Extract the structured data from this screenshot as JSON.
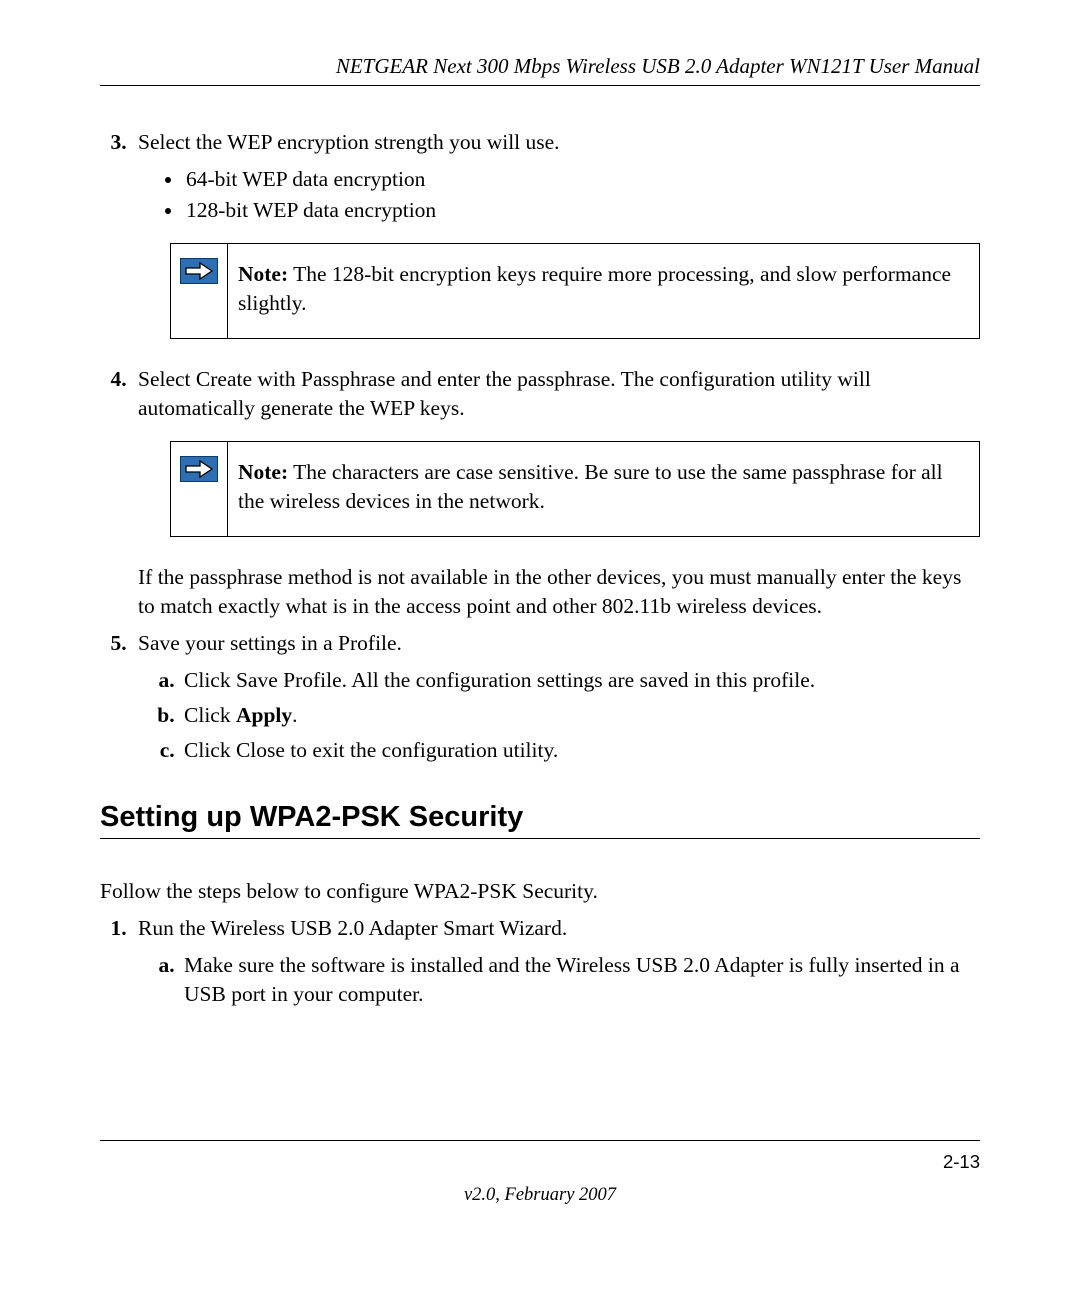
{
  "header": {
    "title": "NETGEAR Next 300 Mbps Wireless USB 2.0 Adapter WN121T User Manual"
  },
  "step3": {
    "text": "Select the WEP encryption strength you will use.",
    "bullets": [
      "64-bit WEP data encryption",
      "128-bit WEP data encryption"
    ]
  },
  "note1": {
    "label": "Note:",
    "text": " The 128-bit encryption keys require more processing, and slow performance slightly."
  },
  "step4": {
    "text": "Select Create with Passphrase and enter the passphrase. The configuration utility will automatically generate the WEP keys."
  },
  "note2": {
    "label": "Note:",
    "text": " The characters are case sensitive. Be sure to use the same passphrase for all the wireless devices in the network."
  },
  "afterNote2": "If the passphrase method is not available in the other devices, you must manually enter the keys to match exactly what is in the access point and other 802.11b wireless devices.",
  "step5": {
    "text": "Save your settings in a Profile.",
    "sub": {
      "a": "Click Save Profile. All the configuration settings are saved in this profile.",
      "b_prefix": "Click ",
      "b_bold": "Apply",
      "b_suffix": ".",
      "c": "Click Close to exit the configuration utility."
    }
  },
  "section": {
    "heading": "Setting up WPA2-PSK Security",
    "intro": "Follow the steps below to configure WPA2-PSK Security."
  },
  "secStep1": {
    "text": "Run the Wireless USB 2.0 Adapter Smart Wizard.",
    "sub": {
      "a": "Make sure the software is installed and the Wireless USB 2.0 Adapter is fully inserted in a USB port in your computer."
    }
  },
  "footer": {
    "pageNumber": "2-13",
    "version": "v2.0, February 2007"
  }
}
